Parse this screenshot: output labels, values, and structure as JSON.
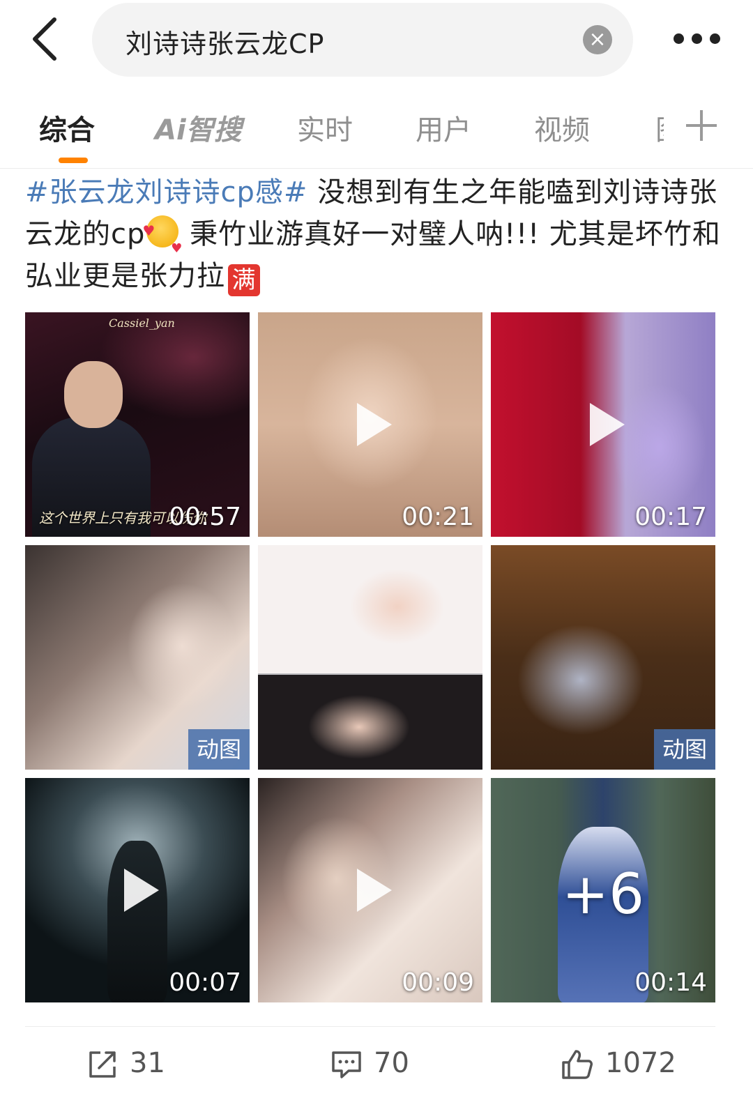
{
  "search": {
    "query": "刘诗诗张云龙CP",
    "clear_symbol": "×"
  },
  "tabs": [
    {
      "label": "综合",
      "active": true
    },
    {
      "label": "Ai智搜",
      "active": false
    },
    {
      "label": "实时",
      "active": false
    },
    {
      "label": "用户",
      "active": false
    },
    {
      "label": "视频",
      "active": false
    },
    {
      "label": "图",
      "active": false
    }
  ],
  "post": {
    "hashtag": "#张云龙刘诗诗cp感#",
    "text_1": " 没想到有生之年能嗑到刘诗诗张云龙的cp",
    "text_2": " 秉竹业游真好一对璧人呐!!! 尤其是坏竹和弘业更是张力拉",
    "emoji_man": "满"
  },
  "media": [
    {
      "type": "video",
      "duration": "00:57",
      "caption": "这个世界上只有我可以伤你",
      "watermark": "Cassiel_yan"
    },
    {
      "type": "video",
      "duration": "00:21"
    },
    {
      "type": "video",
      "duration": "00:17"
    },
    {
      "type": "gif",
      "badge": "动图"
    },
    {
      "type": "image"
    },
    {
      "type": "gif",
      "badge": "动图"
    },
    {
      "type": "video",
      "duration": "00:07"
    },
    {
      "type": "video",
      "duration": "00:09"
    },
    {
      "type": "video",
      "duration": "00:14",
      "more": "+6"
    }
  ],
  "actions": {
    "share_count": "31",
    "comment_count": "70",
    "like_count": "1072"
  },
  "colors": {
    "accent": "#ff8200",
    "hashtag": "#4a7bb7",
    "badge": "#466eaa"
  }
}
